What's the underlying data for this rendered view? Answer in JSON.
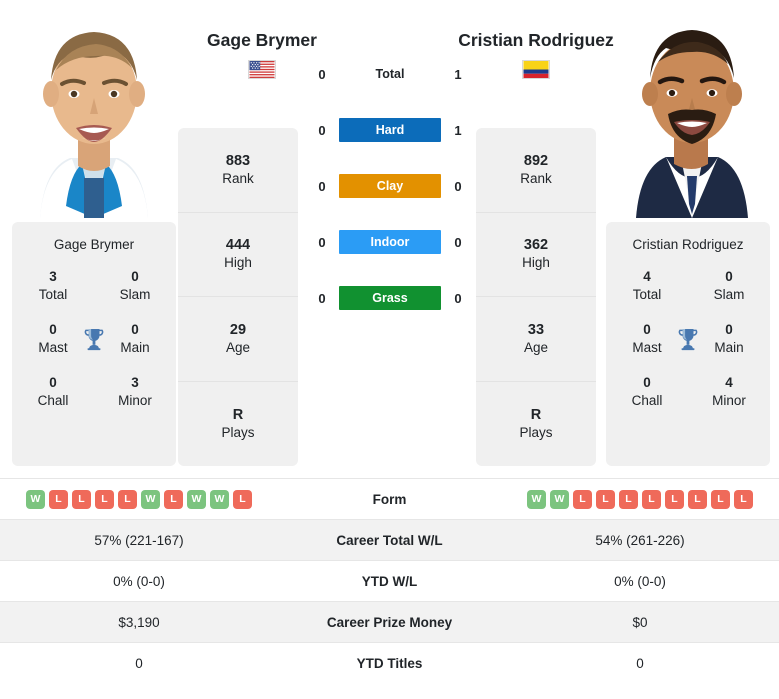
{
  "players": {
    "left": {
      "name": "Gage Brymer",
      "flag": "us-flag-icon",
      "card_name": "Gage Brymer",
      "rank": "883",
      "rank_label": "Rank",
      "high": "444",
      "high_label": "High",
      "age": "29",
      "age_label": "Age",
      "plays": "R",
      "plays_label": "Plays",
      "titles": {
        "total": "3",
        "total_label": "Total",
        "slam": "0",
        "slam_label": "Slam",
        "mast": "0",
        "mast_label": "Mast",
        "main": "0",
        "main_label": "Main",
        "chall": "0",
        "chall_label": "Chall",
        "minor": "3",
        "minor_label": "Minor"
      },
      "form": [
        "W",
        "L",
        "L",
        "L",
        "L",
        "W",
        "L",
        "W",
        "W",
        "L"
      ],
      "career_wl": "57% (221-167)",
      "ytd_wl": "0% (0-0)",
      "prize": "$3,190",
      "ytd_titles": "0"
    },
    "right": {
      "name": "Cristian Rodriguez",
      "flag": "colombia-flag-icon",
      "card_name": "Cristian Rodriguez",
      "rank": "892",
      "rank_label": "Rank",
      "high": "362",
      "high_label": "High",
      "age": "33",
      "age_label": "Age",
      "plays": "R",
      "plays_label": "Plays",
      "titles": {
        "total": "4",
        "total_label": "Total",
        "slam": "0",
        "slam_label": "Slam",
        "mast": "0",
        "mast_label": "Mast",
        "main": "0",
        "main_label": "Main",
        "chall": "0",
        "chall_label": "Chall",
        "minor": "4",
        "minor_label": "Minor"
      },
      "form": [
        "W",
        "W",
        "L",
        "L",
        "L",
        "L",
        "L",
        "L",
        "L",
        "L"
      ],
      "career_wl": "54% (261-226)",
      "ytd_wl": "0% (0-0)",
      "prize": "$0",
      "ytd_titles": "0"
    }
  },
  "h2h": {
    "rows": [
      {
        "label": "Total",
        "left": "0",
        "right": "1",
        "color": ""
      },
      {
        "label": "Hard",
        "left": "0",
        "right": "1",
        "color": "#0c6cba"
      },
      {
        "label": "Clay",
        "left": "0",
        "right": "0",
        "color": "#e39100"
      },
      {
        "label": "Indoor",
        "left": "0",
        "right": "0",
        "color": "#2b9cf5"
      },
      {
        "label": "Grass",
        "left": "0",
        "right": "0",
        "color": "#119130"
      }
    ]
  },
  "table": {
    "rows": [
      {
        "label": "Form",
        "type": "form"
      },
      {
        "label": "Career Total W/L",
        "type": "text",
        "key": "career_wl"
      },
      {
        "label": "YTD W/L",
        "type": "text",
        "key": "ytd_wl"
      },
      {
        "label": "Career Prize Money",
        "type": "text",
        "key": "prize"
      },
      {
        "label": "YTD Titles",
        "type": "text",
        "key": "ytd_titles"
      }
    ]
  },
  "colors": {
    "win": "#7cc47f",
    "loss": "#ef6a5a",
    "card_bg": "#f0f0f0",
    "row_alt": "#f2f2f2"
  }
}
